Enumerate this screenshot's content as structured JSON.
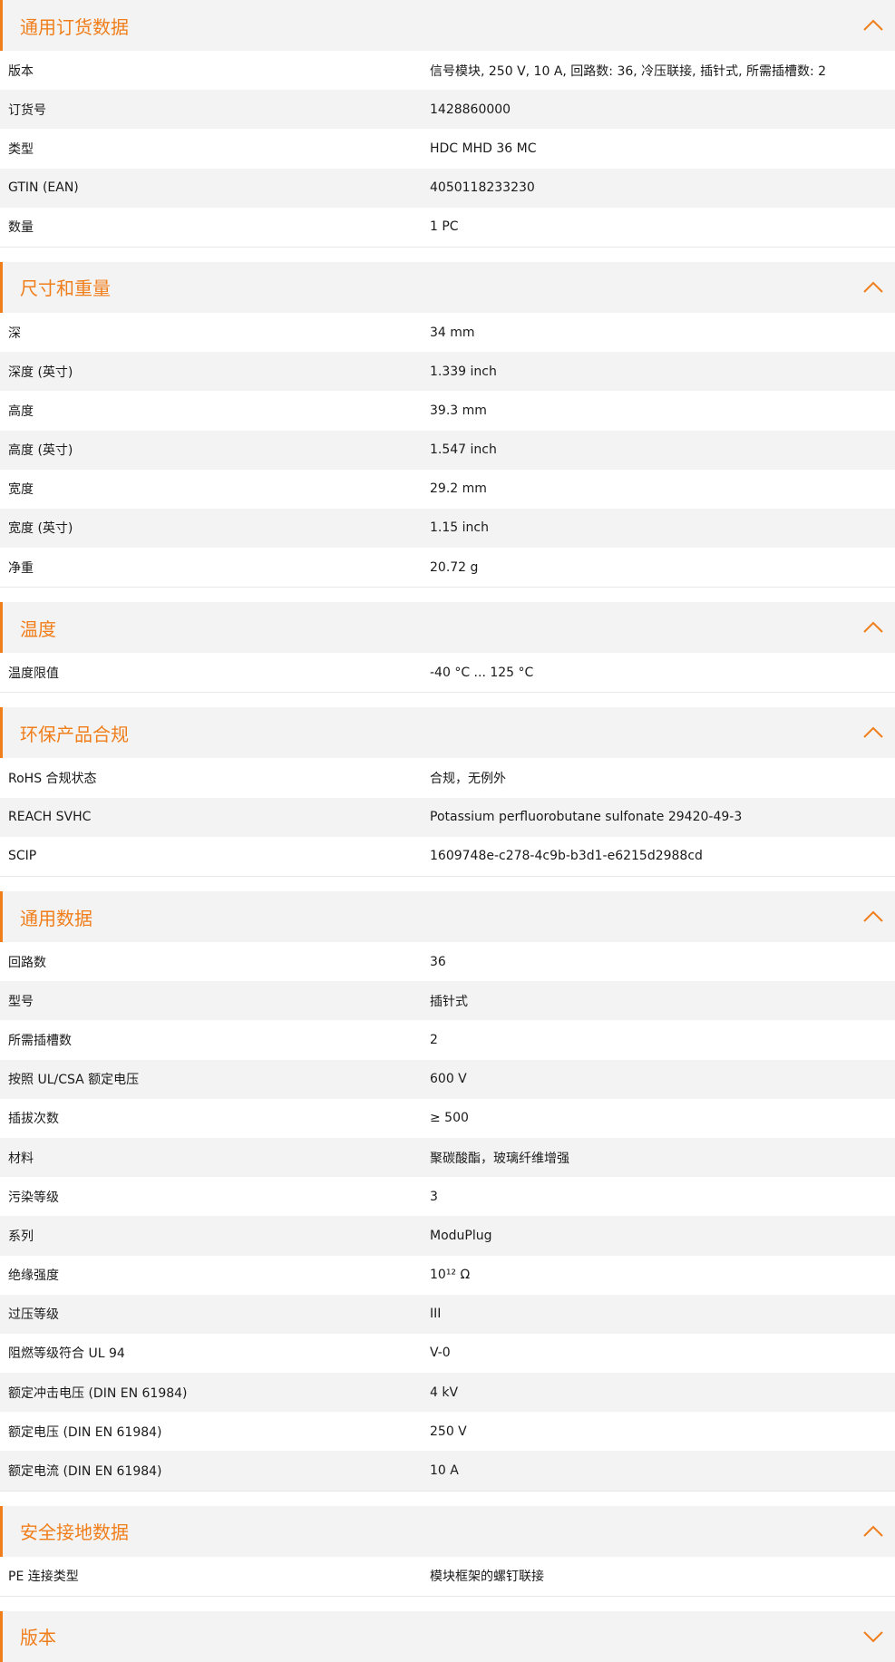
{
  "accent_color": "#f07e1b",
  "sections": [
    {
      "title": "通用订货数据",
      "icon": "chevron-up-icon",
      "rows": [
        {
          "label": "版本",
          "value": "信号模块, 250 V, 10 A, 回路数: 36, 冷压联接, 插针式, 所需插槽数: 2"
        },
        {
          "label": "订货号",
          "value": "1428860000"
        },
        {
          "label": "类型",
          "value": "HDC MHD 36 MC"
        },
        {
          "label": "GTIN (EAN)",
          "value": "4050118233230"
        },
        {
          "label": "数量",
          "value": "1  PC"
        }
      ]
    },
    {
      "title": "尺寸和重量",
      "icon": "chevron-up-icon",
      "rows": [
        {
          "label": "深",
          "value": "34  mm"
        },
        {
          "label": "深度 (英寸)",
          "value": "1.339  inch"
        },
        {
          "label": "高度",
          "value": "39.3  mm"
        },
        {
          "label": "高度 (英寸)",
          "value": "1.547  inch"
        },
        {
          "label": "宽度",
          "value": "29.2  mm"
        },
        {
          "label": "宽度 (英寸)",
          "value": "1.15  inch"
        },
        {
          "label": "净重",
          "value": "20.72  g"
        }
      ]
    },
    {
      "title": "温度",
      "icon": "chevron-up-icon",
      "rows": [
        {
          "label": "温度限值",
          "value": "-40 °C ... 125 °C"
        }
      ]
    },
    {
      "title": "环保产品合规",
      "icon": "chevron-up-icon",
      "rows": [
        {
          "label": "RoHS 合规状态",
          "value": "合规，无例外"
        },
        {
          "label": "REACH SVHC",
          "value": "Potassium perfluorobutane sulfonate 29420-49-3"
        },
        {
          "label": "SCIP",
          "value": "1609748e-c278-4c9b-b3d1-e6215d2988cd"
        }
      ]
    },
    {
      "title": "通用数据",
      "icon": "chevron-up-icon",
      "rows": [
        {
          "label": "回路数",
          "value": "36"
        },
        {
          "label": "型号",
          "value": "插针式"
        },
        {
          "label": "所需插槽数",
          "value": "2"
        },
        {
          "label": "按照 UL/CSA 额定电压",
          "value": "600 V"
        },
        {
          "label": "插拔次数",
          "value": "≥ 500"
        },
        {
          "label": "材料",
          "value": "聚碳酸酯，玻璃纤维增强"
        },
        {
          "label": "污染等级",
          "value": "3"
        },
        {
          "label": "系列",
          "value": "ModuPlug"
        },
        {
          "label": "绝缘强度",
          "value": "10¹² Ω"
        },
        {
          "label": "过压等级",
          "value": "III"
        },
        {
          "label": "阻燃等级符合 UL 94",
          "value": "V-0"
        },
        {
          "label": "额定冲击电压 (DIN EN 61984)",
          "value": "4  kV"
        },
        {
          "label": "额定电压 (DIN EN 61984)",
          "value": "250  V"
        },
        {
          "label": "额定电流 (DIN EN 61984)",
          "value": "10  A"
        }
      ]
    },
    {
      "title": "安全接地数据",
      "icon": "chevron-up-icon",
      "rows": [
        {
          "label": "PE 连接类型",
          "value": "模块框架的螺钉联接"
        }
      ]
    },
    {
      "title": "版本",
      "icon": "chevron-down-icon",
      "rows": []
    }
  ]
}
